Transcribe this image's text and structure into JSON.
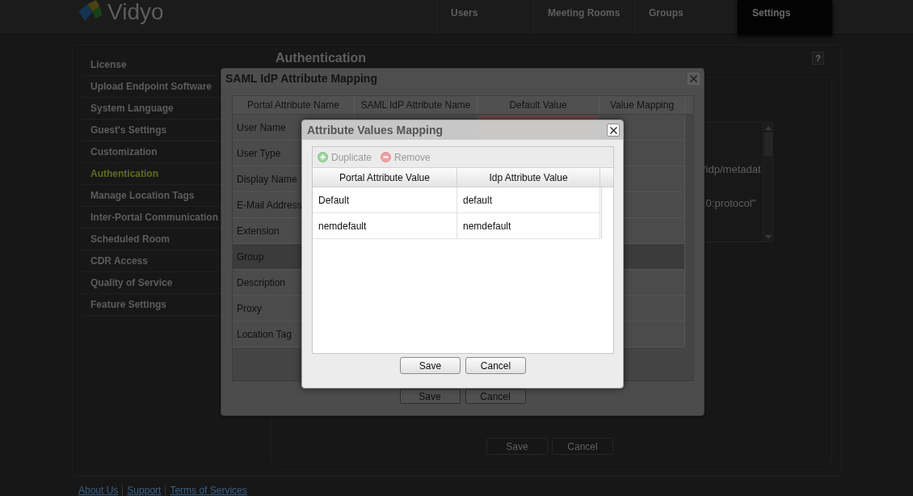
{
  "header": {
    "logo": "Vidyo",
    "tabs": [
      {
        "label": "Users",
        "selected": false
      },
      {
        "label": "Meeting Rooms",
        "selected": false
      },
      {
        "label": "Groups",
        "selected": false
      },
      {
        "label": "Settings",
        "selected": true
      }
    ]
  },
  "sidebar": {
    "items": [
      {
        "label": "License",
        "selected": false
      },
      {
        "label": "Upload Endpoint Software",
        "selected": false
      },
      {
        "label": "System Language",
        "selected": false
      },
      {
        "label": "Guest's Settings",
        "selected": false
      },
      {
        "label": "Customization",
        "selected": false
      },
      {
        "label": "Authentication",
        "selected": true
      },
      {
        "label": "Manage Location Tags",
        "selected": false
      },
      {
        "label": "Inter-Portal Communication",
        "selected": false
      },
      {
        "label": "Scheduled Room",
        "selected": false
      },
      {
        "label": "CDR Access",
        "selected": false
      },
      {
        "label": "Quality of Service",
        "selected": false
      },
      {
        "label": "Feature Settings",
        "selected": false
      }
    ]
  },
  "content": {
    "title": "Authentication",
    "help": "?",
    "metadata_field": {
      "lines": [
        "/idp/metadat",
        ".0:protocol\""
      ]
    },
    "buttons": [
      "Save",
      "Cancel"
    ]
  },
  "footer": {
    "links": [
      "About Us",
      "Support",
      "Terms of Services"
    ]
  },
  "saml_dialog": {
    "title": "SAML IdP Attribute Mapping",
    "columns": [
      "Portal Attribute Name",
      "SAML IdP Attribute Name",
      "Default Value",
      "Value Mapping"
    ],
    "rows": [
      {
        "name": "User Name",
        "selected": false,
        "default_invalid": true
      },
      {
        "name": "User Type",
        "selected": false
      },
      {
        "name": "Display Name",
        "selected": false
      },
      {
        "name": "E-Mail Address",
        "selected": false
      },
      {
        "name": "Extension",
        "selected": false
      },
      {
        "name": "Group",
        "selected": true
      },
      {
        "name": "Description",
        "selected": false
      },
      {
        "name": "Proxy",
        "selected": false
      },
      {
        "name": "Location Tag",
        "selected": false
      }
    ],
    "buttons": [
      "Save",
      "Cancel"
    ]
  },
  "values_dialog": {
    "title": "Attribute Values Mapping",
    "toolbar": [
      {
        "kind": "add",
        "label": "Duplicate",
        "disabled": true
      },
      {
        "kind": "remove",
        "label": "Remove",
        "disabled": true
      }
    ],
    "columns": [
      "Portal Attribute Value",
      "Idp Attribute Value"
    ],
    "rows": [
      {
        "portal": "Default",
        "idp": "default"
      },
      {
        "portal": "nemdefault",
        "idp": "nemdefault"
      }
    ],
    "buttons": [
      "Save",
      "Cancel"
    ]
  }
}
